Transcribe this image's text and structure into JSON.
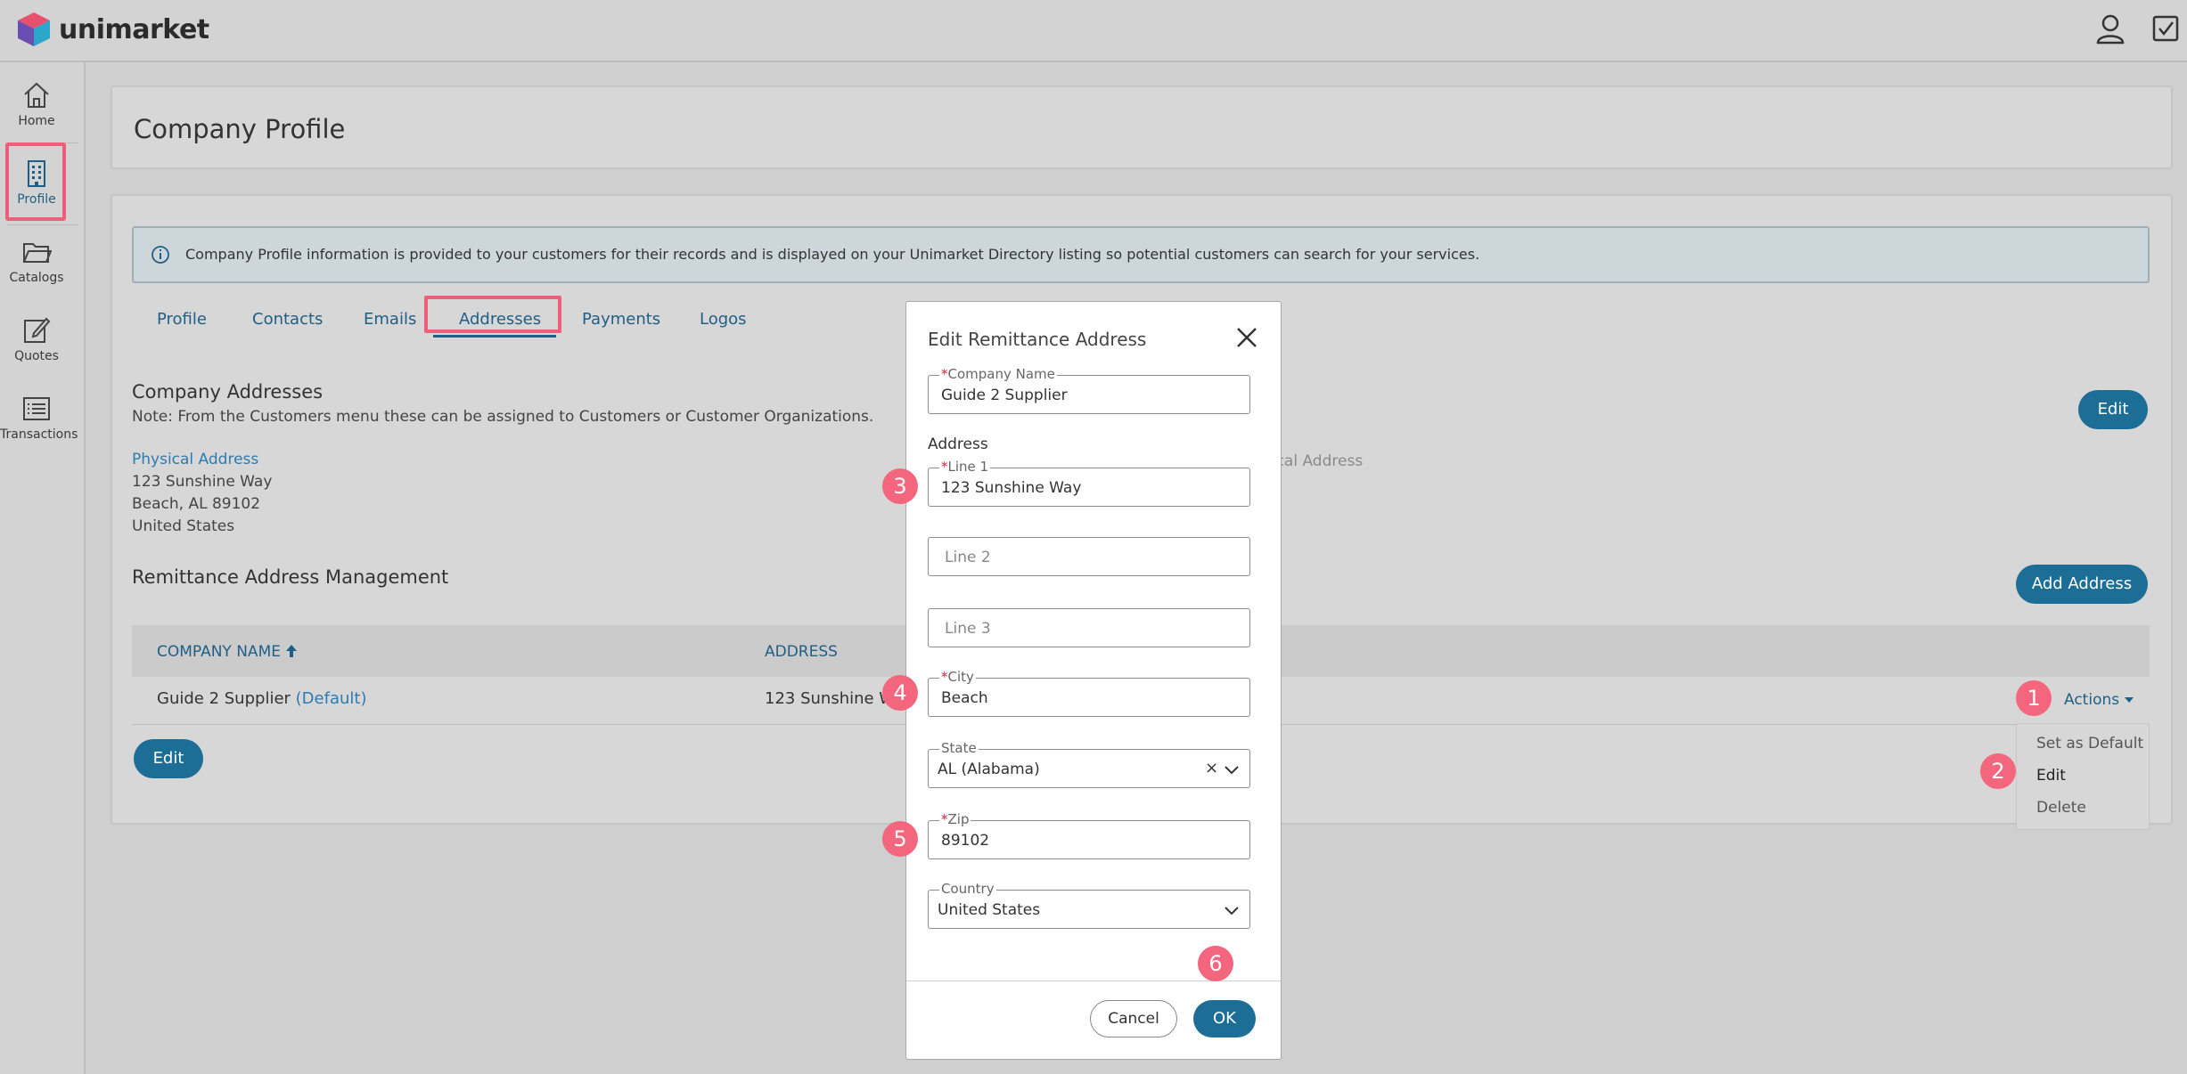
{
  "app": {
    "brand": "unimarket"
  },
  "sidebar": {
    "items": [
      {
        "label": "Home",
        "icon": "home-icon"
      },
      {
        "label": "Profile",
        "icon": "building-icon"
      },
      {
        "label": "Catalogs",
        "icon": "folder-icon"
      },
      {
        "label": "Quotes",
        "icon": "edit-icon"
      },
      {
        "label": "Transactions",
        "icon": "list-icon"
      }
    ]
  },
  "page": {
    "title": "Company Profile",
    "info": "Company Profile information is provided to your customers for their records and is displayed on your Unimarket Directory listing so potential customers can search for your services."
  },
  "tabs": [
    "Profile",
    "Contacts",
    "Emails",
    "Addresses",
    "Payments",
    "Logos"
  ],
  "active_tab": "Addresses",
  "company_addresses": {
    "title": "Company Addresses",
    "note": "Note: From the Customers menu these can be assigned to Customers or Customer Organizations.",
    "edit_label": "Edit",
    "physical": {
      "label": "Physical Address",
      "line1": "123 Sunshine Way",
      "line2": "Beach, AL 89102",
      "line3": "United States"
    },
    "faded_text": "sical Address"
  },
  "remittance": {
    "title": "Remittance Address Management",
    "add_label": "Add Address",
    "columns": [
      "COMPANY NAME",
      "ADDRESS"
    ],
    "sort_icon": "arrow-up-icon",
    "rows": [
      {
        "company": "Guide 2 Supplier",
        "default_tag": "(Default)",
        "address": "123 Sunshine Wa"
      }
    ],
    "edit_label": "Edit",
    "actions_label": "Actions",
    "menu": [
      "Set as Default",
      "Edit",
      "Delete"
    ]
  },
  "dialog": {
    "title": "Edit Remittance Address",
    "company_name": {
      "label": "Company Name",
      "value": "Guide 2 Supplier",
      "required": "*"
    },
    "address_label": "Address",
    "line1": {
      "label": "Line 1",
      "value": "123 Sunshine Way",
      "required": "*"
    },
    "line2": {
      "placeholder": "Line 2"
    },
    "line3": {
      "placeholder": "Line 3"
    },
    "city": {
      "label": "City",
      "value": "Beach",
      "required": "*"
    },
    "state": {
      "label": "State",
      "value": "AL (Alabama)",
      "clear": "×"
    },
    "zip": {
      "label": "Zip",
      "value": "89102",
      "required": "*"
    },
    "country": {
      "label": "Country",
      "value": "United States"
    },
    "cancel_label": "Cancel",
    "ok_label": "OK"
  },
  "badges": [
    "1",
    "2",
    "3",
    "4",
    "5",
    "6"
  ],
  "colors": {
    "accent": "#1c6e96",
    "badge": "#f4667d",
    "highlight": "#ee5d7a",
    "link": "#2f7ab0"
  }
}
